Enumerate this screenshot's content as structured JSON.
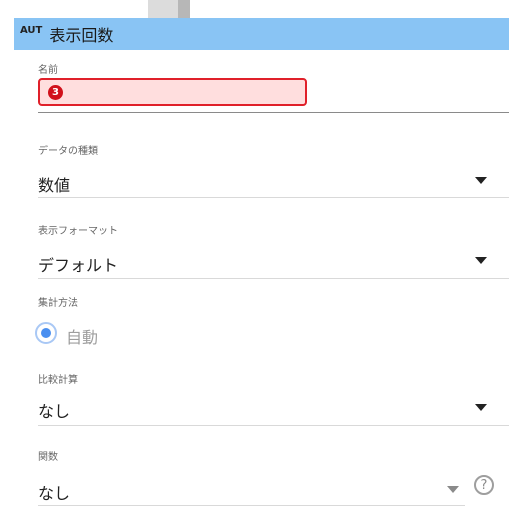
{
  "header": {
    "tag": "AUT",
    "title": "表示回数"
  },
  "name_field": {
    "label": "名前",
    "value": "",
    "badge": "3"
  },
  "data_type": {
    "label": "データの種類",
    "value": "数値"
  },
  "display_format": {
    "label": "表示フォーマット",
    "value": "デフォルト"
  },
  "aggregation": {
    "label": "集計方法",
    "option": "自動",
    "selected": true
  },
  "comparison": {
    "label": "比較計算",
    "value": "なし"
  },
  "function": {
    "label": "関数",
    "value": "なし",
    "help": "?"
  },
  "colors": {
    "header_bg": "#89c4f4",
    "error_border": "#e0202a",
    "error_bg": "#ffdede",
    "radio_accent": "#4a8ff0"
  }
}
